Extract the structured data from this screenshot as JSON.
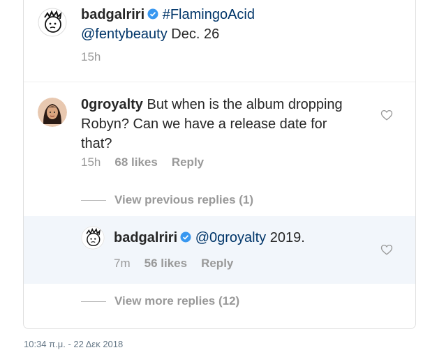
{
  "caption": {
    "username": "badgalriri",
    "hashtag": "#FlamingoAcid",
    "mention": "@fentybeauty",
    "text_tail": " Dec. 26",
    "time": "15h"
  },
  "comment": {
    "username": "0groyalty",
    "text": " But when is the album dropping Robyn? Can we have a release date for that?",
    "time": "15h",
    "likes": "68 likes",
    "reply_label": "Reply"
  },
  "view_previous": "View previous replies (1)",
  "reply": {
    "username": "badgalriri",
    "mention": "@0groyalty",
    "text_tail": " 2019.",
    "time": "7m",
    "likes": "56 likes",
    "reply_label": "Reply"
  },
  "view_more": "View more replies (12)",
  "timestamp": "10:34 π.μ. - 22 Δεκ 2018",
  "colors": {
    "verified": "#3897f0",
    "link": "#003569",
    "muted": "#999999",
    "highlight_bg": "#f2f6fb"
  }
}
